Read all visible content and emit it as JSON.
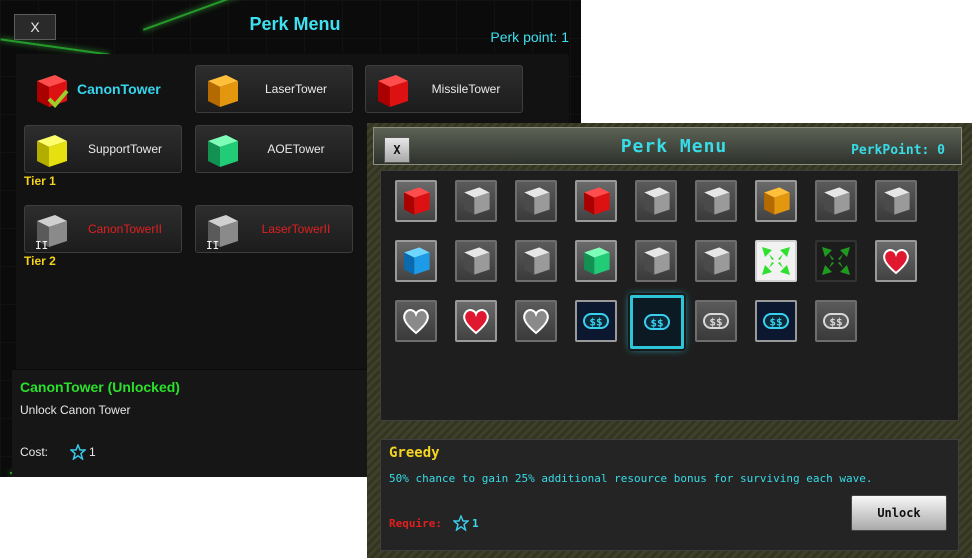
{
  "main_window": {
    "close_label": "X",
    "title": "Perk Menu",
    "perk_points": "Perk point: 1",
    "towers": [
      {
        "label": "CanonTower",
        "color": "#d01010",
        "state": "selected"
      },
      {
        "label": "LaserTower",
        "color": "#e3970f",
        "state": "normal"
      },
      {
        "label": "MissileTower",
        "color": "#d01010",
        "state": "normal"
      },
      {
        "label": "SupportTower",
        "color": "#e6e010",
        "state": "normal"
      },
      {
        "label": "AOETower",
        "color": "#22cc77",
        "state": "normal"
      },
      {
        "label": "CanonTowerII",
        "color": "#8a8a8a",
        "state": "locked"
      },
      {
        "label": "LaserTowerII",
        "color": "#8a8a8a",
        "state": "locked"
      }
    ],
    "tier_labels": [
      "Tier 1",
      "Tier 2"
    ],
    "selected_name": "CanonTower (Unlocked)",
    "selected_desc": "Unlock Canon Tower",
    "cost_label": "Cost:",
    "cost_value": "1"
  },
  "perk_window": {
    "close_label": "X",
    "title": "Perk Menu",
    "perk_points": "PerkPoint: 0",
    "perk_grid": [
      [
        "red-cube",
        "gray-cube",
        "gray-cube",
        "red-cube",
        "gray-cube",
        "gray-cube",
        "orange-cube",
        "gray-cube",
        "gray-cube"
      ],
      [
        "blue-cube",
        "gray-cube",
        "gray-cube",
        "green-cube",
        "gray-cube",
        "gray-cube",
        "green-arrows",
        "green-arrows-dark",
        "red-heart"
      ],
      [
        "gray-heart",
        "red-heart",
        "gray-heart",
        "money-blue",
        "money-blue-selected",
        "money-gray",
        "money-blue",
        "money-gray"
      ]
    ],
    "perk_name": "Greedy",
    "perk_desc": "50% chance to gain 25% additional resource bonus for surviving each wave.",
    "require_label": "Require:",
    "require_value": "1",
    "unlock_label": "Unlock"
  }
}
